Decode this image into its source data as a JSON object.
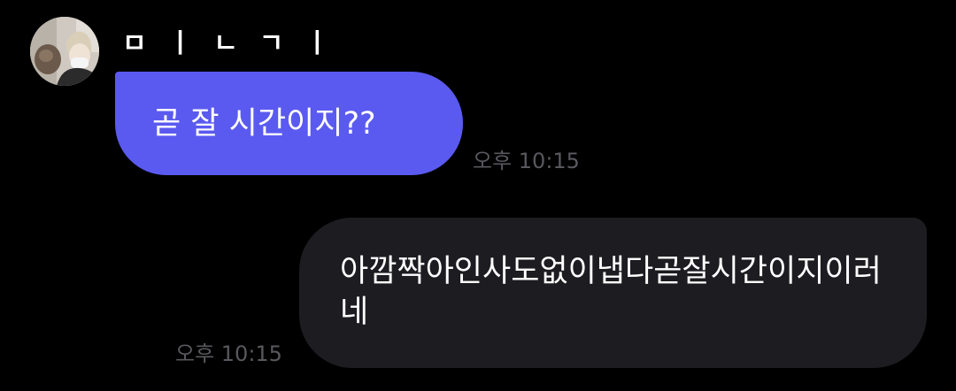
{
  "chat": {
    "incoming": {
      "sender_name": "ㅁㅣㄴㄱㅣ",
      "text": "곧 잘 시간이지??",
      "time": "오후 10:15",
      "avatar_icon": "profile-photo-avatar"
    },
    "outgoing": {
      "text": "아깜짝아인사도없이냅다곧잘시간이지이러네",
      "time": "오후 10:15"
    }
  },
  "colors": {
    "background": "#000000",
    "incoming_bubble": "#5a5af0",
    "outgoing_bubble": "#1c1c21",
    "timestamp": "#58585e",
    "text": "#ffffff"
  }
}
